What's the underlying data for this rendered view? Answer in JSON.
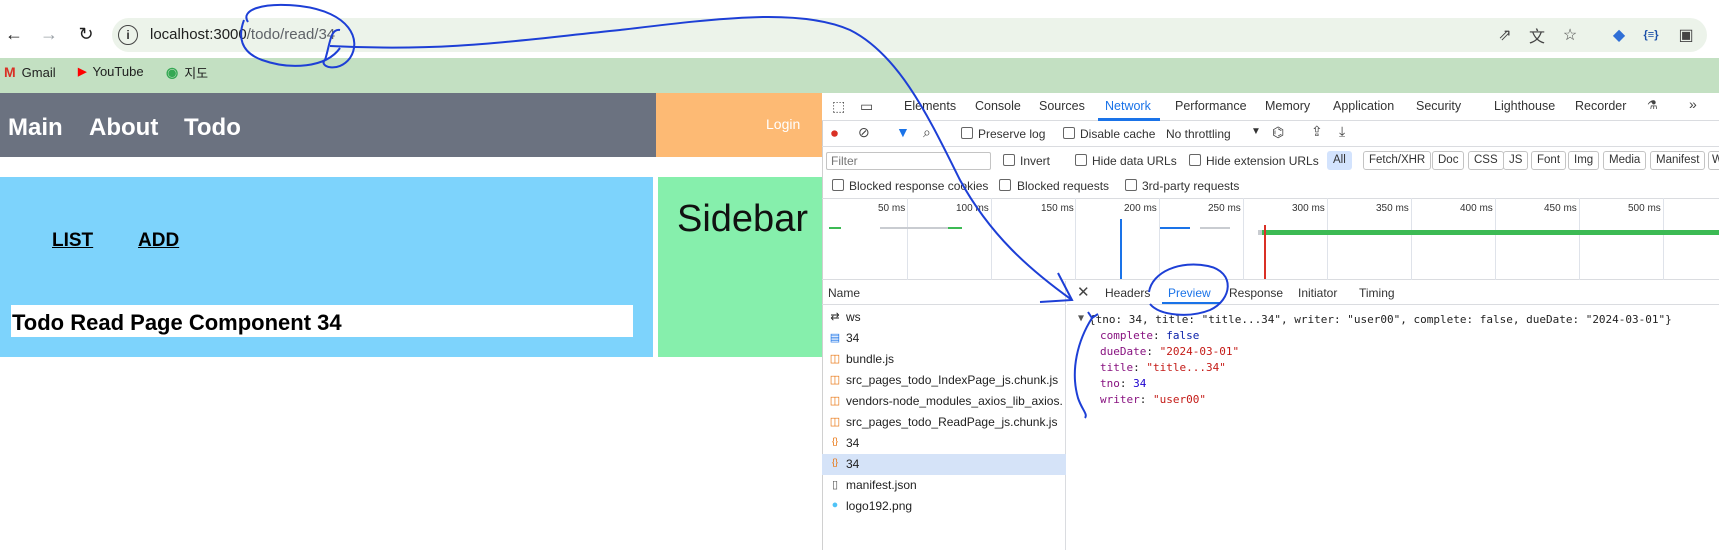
{
  "browser": {
    "url_host": "localhost:3000",
    "url_path": "/todo/read/34",
    "bookmarks": [
      {
        "label": "Gmail",
        "icon": "gmail-icon",
        "color": "#d93025"
      },
      {
        "label": "YouTube",
        "icon": "youtube-icon",
        "color": "#ff0000"
      },
      {
        "label": "지도",
        "icon": "maps-icon",
        "color": "#34a853"
      }
    ]
  },
  "app": {
    "nav": [
      "Main",
      "About",
      "Todo"
    ],
    "login": "Login",
    "links": [
      "LIST",
      "ADD"
    ],
    "read_title": "Todo Read Page Component 34",
    "sidebar_title": "Sidebar"
  },
  "devtools": {
    "tabs": [
      "Elements",
      "Console",
      "Sources",
      "Network",
      "Performance",
      "Memory",
      "Application",
      "Security",
      "Lighthouse",
      "Recorder"
    ],
    "active_tab": "Network",
    "preserve_log": "Preserve log",
    "disable_cache": "Disable cache",
    "throttling": "No throttling",
    "filter_placeholder": "Filter",
    "invert": "Invert",
    "hide_data_urls": "Hide data URLs",
    "hide_extension_urls": "Hide extension URLs",
    "type_filters": [
      "All",
      "Fetch/XHR",
      "Doc",
      "CSS",
      "JS",
      "Font",
      "Img",
      "Media",
      "Manifest",
      "W"
    ],
    "blocked_cookies": "Blocked response cookies",
    "blocked_requests": "Blocked requests",
    "third_party": "3rd-party requests",
    "timeline_ticks": [
      "50 ms",
      "100 ms",
      "150 ms",
      "200 ms",
      "250 ms",
      "300 ms",
      "350 ms",
      "400 ms",
      "450 ms",
      "500 ms"
    ],
    "name_header": "Name",
    "requests": [
      {
        "name": "ws",
        "icon": "websocket-icon"
      },
      {
        "name": "34",
        "icon": "document-icon"
      },
      {
        "name": "bundle.js",
        "icon": "script-icon"
      },
      {
        "name": "src_pages_todo_IndexPage_js.chunk.js",
        "icon": "script-icon"
      },
      {
        "name": "vendors-node_modules_axios_lib_axios...",
        "icon": "script-icon"
      },
      {
        "name": "src_pages_todo_ReadPage_js.chunk.js",
        "icon": "script-icon"
      },
      {
        "name": "34",
        "icon": "fetch-icon"
      },
      {
        "name": "34",
        "icon": "fetch-icon",
        "selected": true
      },
      {
        "name": "manifest.json",
        "icon": "file-icon"
      },
      {
        "name": "logo192.png",
        "icon": "image-icon"
      }
    ],
    "detail_tabs": [
      "Headers",
      "Preview",
      "Response",
      "Initiator",
      "Timing"
    ],
    "active_detail_tab": "Preview",
    "preview_summary": "{tno: 34, title: \"title...34\", writer: \"user00\", complete: false, dueDate: \"2024-03-01\"}",
    "preview_fields": [
      {
        "key": "complete",
        "value": "false",
        "type": "bool"
      },
      {
        "key": "dueDate",
        "value": "\"2024-03-01\"",
        "type": "string"
      },
      {
        "key": "title",
        "value": "\"title...34\"",
        "type": "string"
      },
      {
        "key": "tno",
        "value": "34",
        "type": "number"
      },
      {
        "key": "writer",
        "value": "\"user00\"",
        "type": "string"
      }
    ]
  },
  "colors": {
    "header": "#6b7280",
    "login_bg": "#fdba74",
    "main_bg": "#7dd3fc",
    "sidebar_bg": "#86efac",
    "bookmarks_bg": "#c3e0c2",
    "annotation_ink": "#1d3fd6",
    "accent": "#1a73e8"
  }
}
